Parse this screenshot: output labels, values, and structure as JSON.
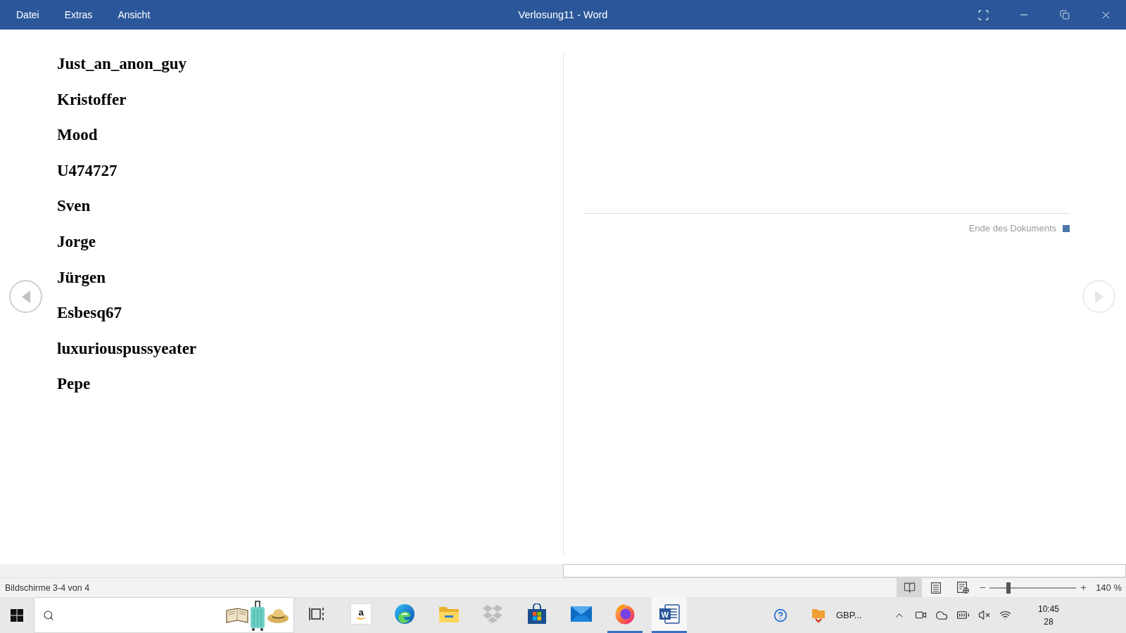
{
  "window": {
    "menu": [
      {
        "label": "Datei"
      },
      {
        "label": "Extras"
      },
      {
        "label": "Ansicht"
      }
    ],
    "title": "Verlosung11 - Word"
  },
  "document": {
    "paragraphs": [
      "Just_an_anon_guy",
      "Kristoffer",
      "Mood",
      "U474727",
      "Sven",
      "Jorge",
      "Jürgen",
      "Esbesq67",
      "luxuriouspussyeater",
      "Pepe"
    ],
    "end_label": "Ende des Dokuments",
    "nav": [
      {
        "kind": "previous",
        "disabled": false
      },
      {
        "kind": "next",
        "disabled": true
      }
    ]
  },
  "status_bar": {
    "page_info": "Bildschirme 3-4 von 4",
    "views": [
      {
        "kind": "read",
        "selected": true
      },
      {
        "kind": "print",
        "selected": false
      },
      {
        "kind": "web",
        "selected": false
      }
    ],
    "zoom": {
      "level": 0.22,
      "reading": "140 %"
    }
  },
  "taskbar": {
    "apps": [
      {
        "kind": "task_view",
        "running": false,
        "selected": false
      },
      {
        "kind": "amazon",
        "label": "a",
        "running": false,
        "selected": false
      },
      {
        "kind": "edge",
        "running": false,
        "selected": false
      },
      {
        "kind": "explorer",
        "running": false,
        "selected": false
      },
      {
        "kind": "dropbox",
        "running": false,
        "selected": false
      },
      {
        "kind": "store",
        "running": false,
        "selected": false
      },
      {
        "kind": "mail",
        "running": false,
        "selected": false
      },
      {
        "kind": "firefox",
        "running": true,
        "selected": false
      },
      {
        "kind": "word",
        "label": "W",
        "running": true,
        "selected": true
      }
    ],
    "tray": {
      "ticker": "GBP...",
      "time": "10:45",
      "date": "28"
    }
  }
}
